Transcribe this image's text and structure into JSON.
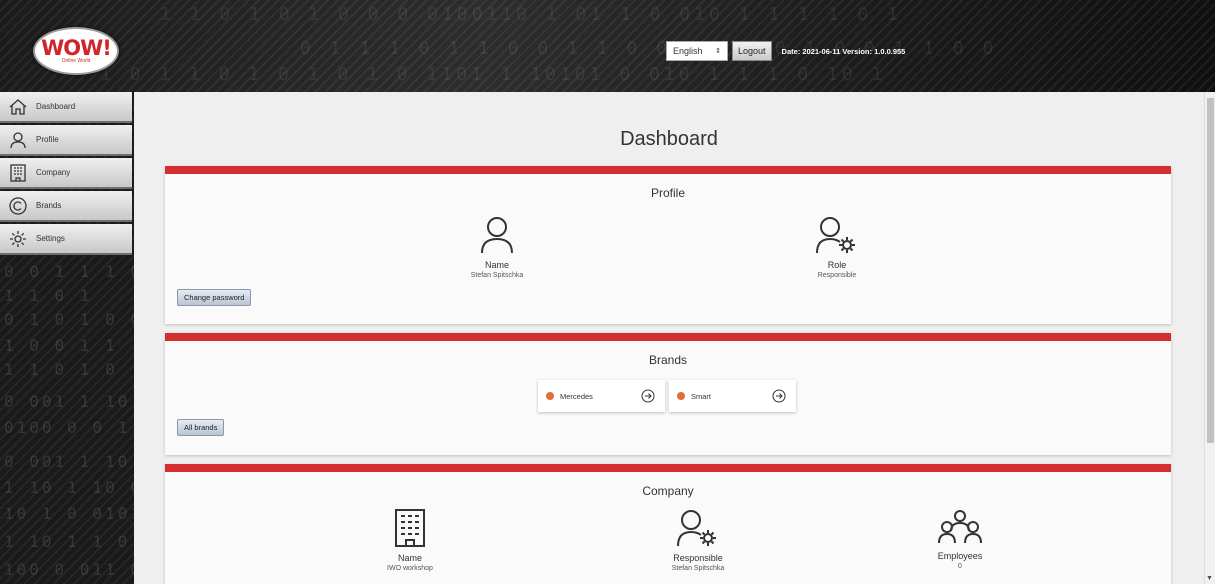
{
  "header": {
    "logo_text": "WOW!",
    "logo_tagline": "Online World",
    "language": "English",
    "logout_label": "Logout",
    "date_version": "Date: 2021-06-11 Version: 1.0.0.955"
  },
  "sidebar": {
    "items": [
      {
        "label": "Dashboard",
        "icon": "home-icon"
      },
      {
        "label": "Profile",
        "icon": "user-icon"
      },
      {
        "label": "Company",
        "icon": "building-icon"
      },
      {
        "label": "Brands",
        "icon": "copyright-icon"
      },
      {
        "label": "Settings",
        "icon": "gear-icon"
      }
    ]
  },
  "main": {
    "title": "Dashboard",
    "profile": {
      "title": "Profile",
      "name_label": "Name",
      "name_value": "Stefan Spitschka",
      "role_label": "Role",
      "role_value": "Responsible",
      "change_password_label": "Change password"
    },
    "brands": {
      "title": "Brands",
      "items": [
        {
          "name": "Mercedes",
          "dot_color": "#e06d3a"
        },
        {
          "name": "Smart",
          "dot_color": "#e06d3a"
        }
      ],
      "all_brands_label": "All brands"
    },
    "company": {
      "title": "Company",
      "name_label": "Name",
      "name_value": "IWO workshop",
      "responsible_label": "Responsible",
      "responsible_value": "Stefan Spitschka",
      "employees_label": "Employees",
      "employees_value": "0"
    }
  },
  "colors": {
    "accent": "#d32f2f",
    "brand_dot": "#e06d3a"
  }
}
